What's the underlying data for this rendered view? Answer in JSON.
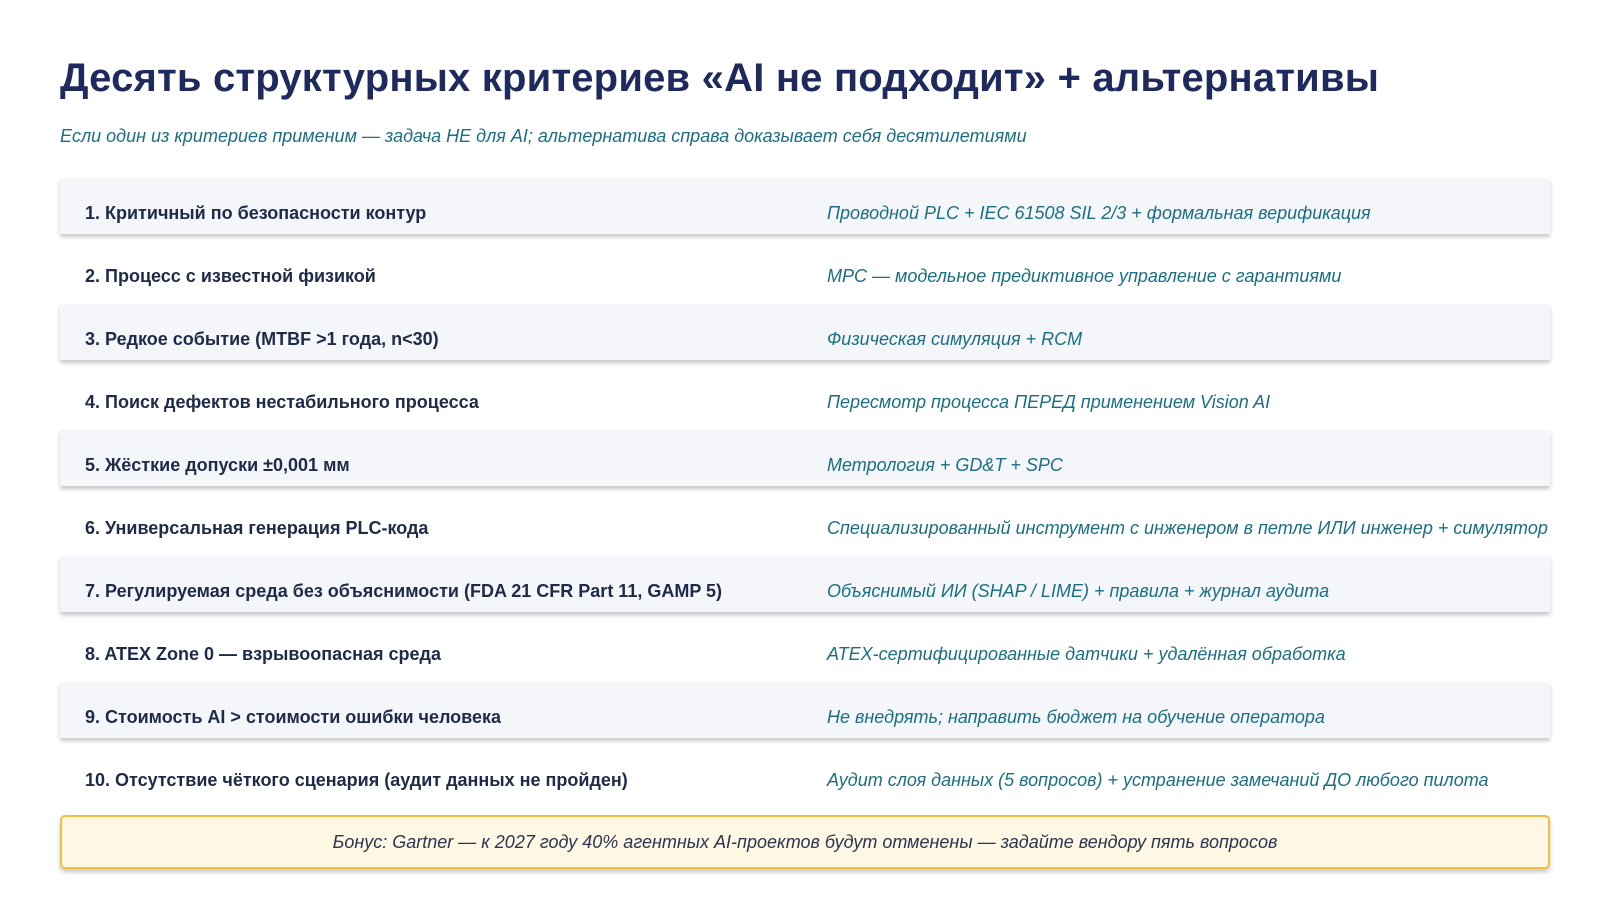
{
  "title": "Десять структурных критериев «AI не подходит» + альтернативы",
  "subtitle": "Если один из критериев применим — задача НЕ для AI; альтернатива справа доказывает себя десятилетиями",
  "rows": [
    {
      "criterion": "1. Критичный по безопасности контур",
      "alternative": "Проводной PLC + IEC 61508 SIL 2/3 + формальная верификация"
    },
    {
      "criterion": "2. Процесс с известной физикой",
      "alternative": "MPC — модельное предиктивное управление с гарантиями"
    },
    {
      "criterion": "3. Редкое событие (MTBF >1 года, n<30)",
      "alternative": "Физическая симуляция + RCM"
    },
    {
      "criterion": "4. Поиск дефектов нестабильного процесса",
      "alternative": "Пересмотр процесса ПЕРЕД применением Vision AI"
    },
    {
      "criterion": "5. Жёсткие допуски ±0,001 мм",
      "alternative": "Метрология + GD&T + SPC"
    },
    {
      "criterion": "6. Универсальная генерация PLC-кода",
      "alternative": "Специализированный инструмент с инженером в петле ИЛИ инженер + симулятор"
    },
    {
      "criterion": "7. Регулируемая среда без объяснимости (FDA 21 CFR Part 11, GAMP 5)",
      "alternative": "Объяснимый ИИ (SHAP / LIME) + правила + журнал аудита"
    },
    {
      "criterion": "8. ATEX Zone 0 — взрывоопасная среда",
      "alternative": "ATEX-сертифицированные датчики + удалённая обработка"
    },
    {
      "criterion": "9. Стоимость AI > стоимости ошибки человека",
      "alternative": "Не внедрять; направить бюджет на обучение оператора"
    },
    {
      "criterion": "10. Отсутствие чёткого сценария (аудит данных не пройден)",
      "alternative": "Аудит слоя данных (5 вопросов) + устранение замечаний ДО любого пилота"
    }
  ],
  "bonus": "Бонус: Gartner — к 2027 году 40% агентных AI-проектов будут отменены — задайте вендору пять вопросов",
  "colors": {
    "title": "#1e2a5e",
    "accent": "#1a6e86",
    "row_shade": "#f4f6f9",
    "bonus_bg": "#fdf7e3",
    "bonus_border": "#f0c040"
  }
}
